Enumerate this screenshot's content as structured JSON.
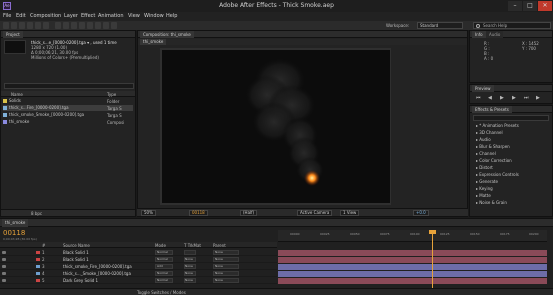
{
  "app": {
    "title": "Adobe After Effects - Thick Smoke.aep",
    "icon": "Ae",
    "window_controls": [
      "–",
      "□",
      "✕"
    ]
  },
  "menu": [
    "File",
    "Edit",
    "Composition",
    "Layer",
    "Effect",
    "Animation",
    "View",
    "Window",
    "Help"
  ],
  "toolbar": {
    "workspace_label": "Workspace:",
    "workspace_value": "Standard",
    "search_placeholder": "Search Help"
  },
  "project": {
    "tab": "Project",
    "selected_name": "thick_s...e_[0000-0200].tga ▾ , used 1 time",
    "info_lines": [
      "1280 x 720 (1.00)",
      "Δ 0;00;06;21, 30.00 fps",
      "Millions of Colors+ (Premultiplied)"
    ],
    "columns": [
      "Name",
      "Type"
    ],
    "items": [
      {
        "name": "Solids",
        "type": "Folder",
        "color": "#d8c24a"
      },
      {
        "name": "thick_s...Fire_[0000-0200].tga",
        "type": "Targa S",
        "color": "#7fb0d8"
      },
      {
        "name": "thick_smoke_Smoke_[0000-0200].tga",
        "type": "Targa S",
        "color": "#7fb0d8"
      },
      {
        "name": "thi_smoke",
        "type": "Composi",
        "color": "#8a8adf"
      }
    ],
    "footer": "8 bpc"
  },
  "composition": {
    "panel_tab": "Composition: thi_smoke",
    "comp_tab": "thi_smoke",
    "zoom": "50%",
    "timecode": "00118",
    "resolution": "(Half)",
    "camera": "Active Camera",
    "views": "1 View",
    "exposure": "+0.0"
  },
  "info": {
    "tab_info": "Info",
    "tab_audio": "Audio",
    "rgba": [
      "R :",
      "G :",
      "B :",
      "A : 0"
    ],
    "coords": [
      "X : 1452",
      "Y : 700"
    ]
  },
  "preview": {
    "tab": "Preview"
  },
  "effects": {
    "tab": "Effects & Presets",
    "search_placeholder": "",
    "categories": [
      "* Animation Presets",
      "3D Channel",
      "Audio",
      "Blur & Sharpen",
      "Channel",
      "Color Correction",
      "Distort",
      "Expression Controls",
      "Generate",
      "Keying",
      "Matte",
      "Noise & Grain"
    ]
  },
  "timeline": {
    "tab": "thi_smoke",
    "timecode": "00118",
    "fps_info": "0;00;03;28 (30.00 fps)",
    "headers": [
      "#",
      "Source Name",
      "Mode",
      "T TrkMat",
      "Parent"
    ],
    "ruler_ticks": [
      "00000",
      "00025",
      "00050",
      "00075",
      "00100",
      "00125",
      "00150",
      "00175",
      "00200"
    ],
    "footer": "Toggle Switches / Modes",
    "layers": [
      {
        "num": "1",
        "name": "Black Solid 1",
        "mode": "Normal",
        "trkmat": "",
        "parent": "None",
        "label": "#cc4444",
        "bar": "#8a4a58"
      },
      {
        "num": "2",
        "name": "Black Solid 1",
        "mode": "Normal",
        "trkmat": "None",
        "parent": "None",
        "label": "#cc4444",
        "bar": "#8a4a58"
      },
      {
        "num": "3",
        "name": "thick_smoke_Fire_[0000-0200].tga",
        "mode": "Add",
        "trkmat": "None",
        "parent": "None",
        "label": "#6fa0d0",
        "bar": "#6d6da8"
      },
      {
        "num": "4",
        "name": "thick_s..._Smoke_[0000-0200].tga",
        "mode": "Normal",
        "trkmat": "None",
        "parent": "None",
        "label": "#6fa0d0",
        "bar": "#6d6da8"
      },
      {
        "num": "5",
        "name": "Dark Grey Solid 1",
        "mode": "Normal",
        "trkmat": "None",
        "parent": "None",
        "label": "#cc4444",
        "bar": "#8a4a58"
      }
    ]
  }
}
